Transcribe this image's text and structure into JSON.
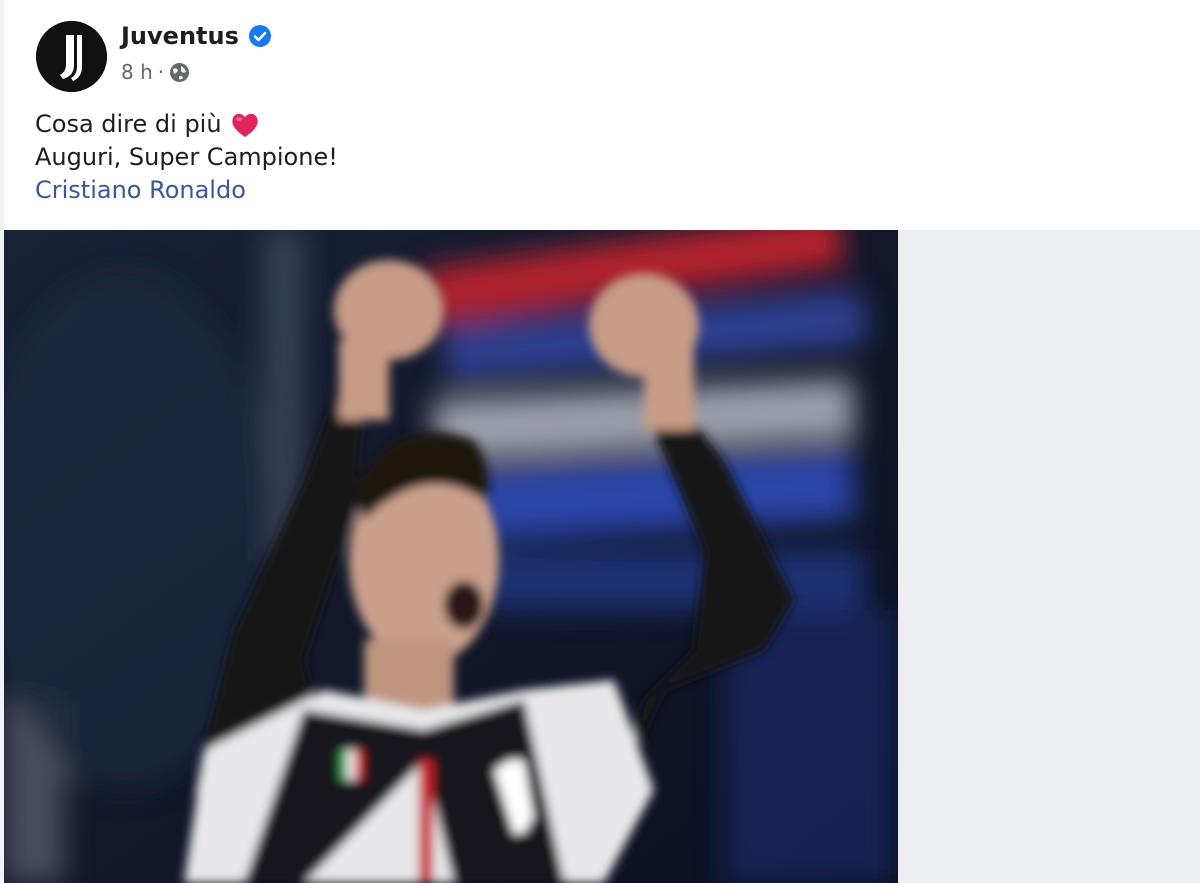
{
  "post": {
    "page_name": "Juventus",
    "timestamp": "8 h",
    "separator": "·",
    "text_line1": "Cosa dire di più",
    "text_line2": "Auguri, Super Campione!",
    "tagged_person": "Cristiano Ronaldo"
  },
  "icons": {
    "verified": "verified-badge-icon",
    "audience": "globe-icon",
    "emoji": "red-heart-icon"
  },
  "colors": {
    "link": "#385898",
    "verified": "#1877f2",
    "meta": "#65676b"
  }
}
